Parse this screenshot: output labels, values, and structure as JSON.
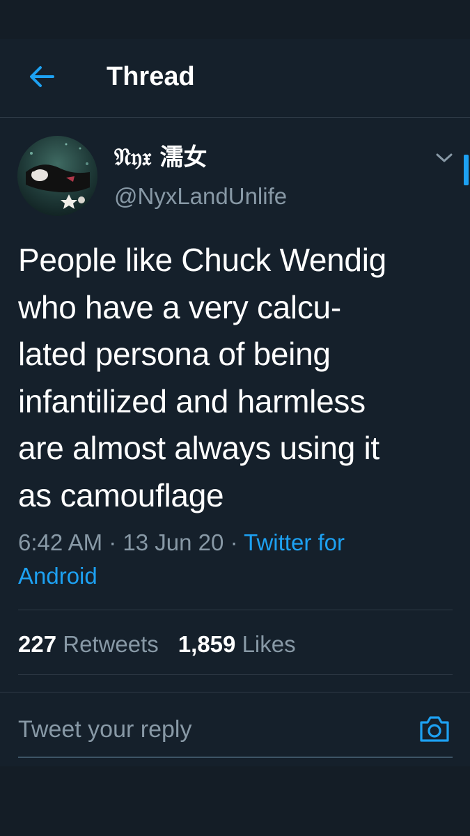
{
  "header": {
    "title": "Thread",
    "back_icon": "arrow-left-icon"
  },
  "tweet": {
    "display_name": "𝔑𝔶𝔵 濡女",
    "handle": "@NyxLandUnlife",
    "text_lines": [
      "People like Chuck Wendig",
      "who have a very calcu-",
      "lated persona of being",
      "infantilized and harmless",
      "are almost always using it",
      "as camouflage"
    ],
    "time": "6:42 AM",
    "date": "13 Jun 20",
    "separator": "·",
    "source": "Twitter for Android",
    "retweets_count": "227",
    "retweets_label": "Retweets",
    "likes_count": "1,859",
    "likes_label": "Likes"
  },
  "reply": {
    "placeholder": "Tweet your reply",
    "camera_icon": "camera-icon"
  },
  "colors": {
    "background": "#15202b",
    "accent": "#1da1f2",
    "secondary_text": "#8899a6",
    "divider": "#2f3b47"
  }
}
